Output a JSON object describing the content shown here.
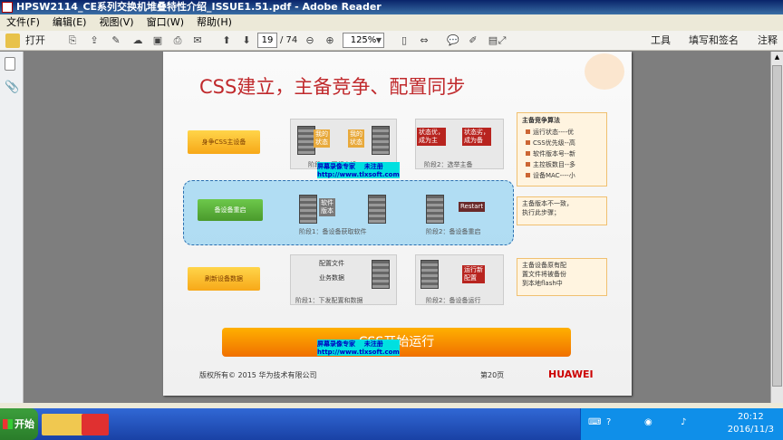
{
  "window": {
    "title": "HPSW2114_CE系列交换机堆叠特性介绍_ISSUE1.51.pdf - Adobe Reader"
  },
  "menu": [
    "文件(F)",
    "编辑(E)",
    "视图(V)",
    "窗口(W)",
    "帮助(H)"
  ],
  "toolbar": {
    "open_label": "打开",
    "page_current": "19",
    "page_total": "/ 74",
    "zoom": "125%",
    "tools_label": "工具",
    "sign_label": "填写和签名",
    "comment_label": "注释"
  },
  "slide": {
    "title": "CSS建立，主备竞争、配置同步",
    "step1_label": "身争CSS主设备",
    "step2_label": "备设备重启",
    "step3_label": "刷新设备数据",
    "my_state_1": "我的\n状态",
    "my_state_2": "我的\n状态",
    "phase1_a": "阶段1：互相交换",
    "phase2_a": "阶段2：选举主备",
    "state_good": "状态优，\n成为主",
    "state_bad": "状态劣，\n成为备",
    "software_version": "软件\n版本",
    "restart_label": "Restart",
    "phase1_b": "阶段1：备设备获取软件",
    "phase2_b": "阶段2：备设备重启",
    "config_file": "配置文件",
    "business_data": "业务数据",
    "running_config": "运行新\n配置",
    "phase1_c": "阶段1：下发配置和数据",
    "phase2_c": "阶段2：备设备运行",
    "algo_title": "主备竞争算法",
    "algo_items": [
      "运行状态----优",
      "CSS优先级--高",
      "软件版本号--新",
      "主控板数目--多",
      "设备MAC----小"
    ],
    "note_version": "主备版本不一致，\n执行此步骤；",
    "note_config": "主备设备原有配\n置文件将被备份\n到本地flash中",
    "final_bar": "CSS开始运行",
    "copyright": "版权所有© 2015 华为技术有限公司",
    "page_label": "第20页",
    "brand": "HUAWEI"
  },
  "watermark": {
    "line1": "屏幕录像专家",
    "line1b": "未注册",
    "line2": "http://www.tlxsoft.com"
  },
  "taskbar": {
    "start_label": "开始",
    "time": "20:12",
    "date": "2016/11/3"
  },
  "colors": {
    "title_red": "#c0292c",
    "accent_orange": "#f7a818",
    "taskbar_blue": "#245edb"
  }
}
